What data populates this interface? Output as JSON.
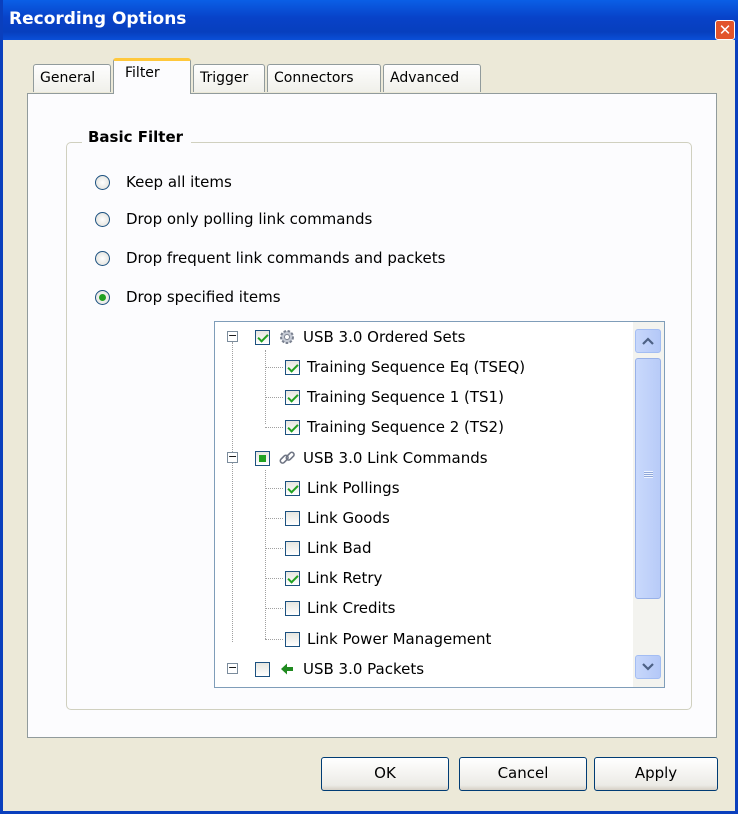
{
  "window": {
    "title": "Recording Options"
  },
  "tabs": [
    {
      "label": "General"
    },
    {
      "label": "Filter"
    },
    {
      "label": "Trigger"
    },
    {
      "label": "Connectors"
    },
    {
      "label": "Advanced"
    }
  ],
  "active_tab": "Filter",
  "basic_filter": {
    "title": "Basic Filter",
    "options": [
      {
        "label": "Keep all items",
        "selected": false
      },
      {
        "label": "Drop only polling link commands",
        "selected": false
      },
      {
        "label": "Drop frequent link commands and packets",
        "selected": false
      },
      {
        "label": "Drop specified items",
        "selected": true
      }
    ]
  },
  "tree": {
    "items": [
      {
        "label": "USB 3.0 Ordered Sets",
        "level": 0,
        "state": "checked",
        "icon": "gear-icon"
      },
      {
        "label": "Training Sequence Eq (TSEQ)",
        "level": 1,
        "state": "checked"
      },
      {
        "label": "Training Sequence 1 (TS1)",
        "level": 1,
        "state": "checked"
      },
      {
        "label": "Training Sequence 2 (TS2)",
        "level": 1,
        "state": "checked"
      },
      {
        "label": "USB 3.0 Link Commands",
        "level": 0,
        "state": "partial",
        "icon": "chain-link-icon"
      },
      {
        "label": "Link Pollings",
        "level": 1,
        "state": "checked"
      },
      {
        "label": "Link Goods",
        "level": 1,
        "state": "unchecked"
      },
      {
        "label": "Link Bad",
        "level": 1,
        "state": "unchecked"
      },
      {
        "label": "Link Retry",
        "level": 1,
        "state": "checked"
      },
      {
        "label": "Link Credits",
        "level": 1,
        "state": "unchecked"
      },
      {
        "label": "Link Power Management",
        "level": 1,
        "state": "unchecked"
      },
      {
        "label": "USB 3.0 Packets",
        "level": 0,
        "state": "unchecked",
        "icon": "green-arrow-icon"
      }
    ]
  },
  "buttons": {
    "ok": "OK",
    "cancel": "Cancel",
    "apply": "Apply"
  },
  "colors": {
    "title_bar": "#0842c8",
    "check_green": "#21a121",
    "tab_highlight": "#ffc83c",
    "dialog_bg": "#ece9d8"
  }
}
